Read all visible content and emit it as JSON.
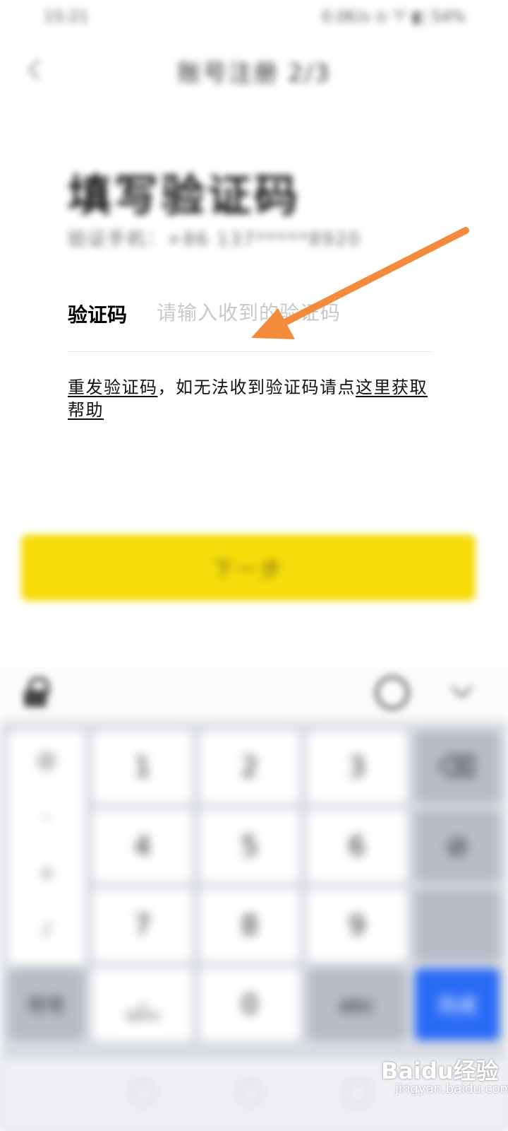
{
  "status_bar": {
    "time": "15:21",
    "icons": "0.0K/s ⊙ ♈ ◧ 54%"
  },
  "nav": {
    "title": "账号注册 2/3"
  },
  "heading": {
    "title": "填写验证码",
    "phone_line": "验证手机：+86 137*****8920"
  },
  "code_field": {
    "label": "验证码",
    "placeholder": "请输入收到的验证码"
  },
  "help": {
    "resend_link": "重发验证码",
    "middle_text": "，如无法收到验证码请点",
    "help_link": "这里获取帮助"
  },
  "next_button": {
    "label": "下一步"
  },
  "keyboard": {
    "symbols": [
      "@",
      "-",
      "+",
      "/"
    ],
    "digits": [
      "1",
      "2",
      "3",
      "4",
      "5",
      "6",
      "7",
      "8",
      "9",
      "0"
    ],
    "delete_label": "⌫",
    "clear_label": "⊘",
    "symbol_key": "符号",
    "space_key": "Space",
    "space_mark": "⎵",
    "switch_key": "abc",
    "done_key": "完成"
  },
  "watermark": {
    "brand": "Baidu经验",
    "domain": "jingyan.baidu.com"
  },
  "colors": {
    "accent_yellow": "#f5dc0a",
    "done_blue": "#2a6bf6",
    "arrow_orange": "#f48a3c"
  }
}
